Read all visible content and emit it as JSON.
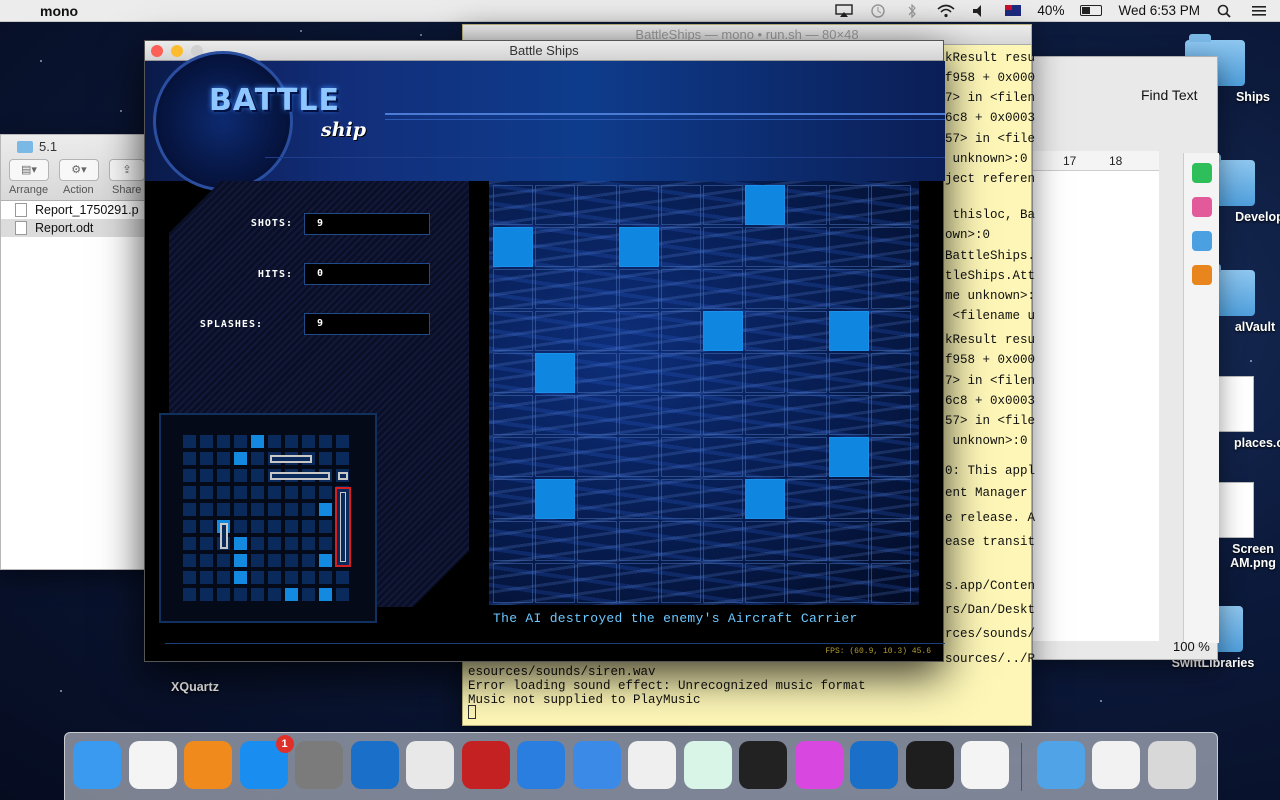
{
  "menubar": {
    "app_name": "mono",
    "battery": "40%",
    "clock": "Wed 6:53 PM"
  },
  "desktop": {
    "icons": [
      {
        "label": "Ships"
      },
      {
        "label": "Developm"
      },
      {
        "label": "alVault"
      },
      {
        "label": "places.o"
      },
      {
        "label": "Screen"
      },
      {
        "label": "AM.png"
      },
      {
        "label": "SwiftLibraries"
      },
      {
        "label": "XQuartz"
      }
    ]
  },
  "finder": {
    "path": "5.1",
    "buttons": {
      "arrange": "Arrange",
      "action": "Action",
      "share": "Share"
    },
    "files": [
      {
        "name": "Report_1750291.p"
      },
      {
        "name": "Report.odt"
      }
    ]
  },
  "docwin": {
    "find_text": "Find Text",
    "ruler": [
      "17",
      "18"
    ],
    "zoom": "100 %"
  },
  "terminal": {
    "title": "BattleShips — mono • run.sh — 80×48",
    "lines": [
      "kResult resu",
      "f958 + 0x000",
      "7> in <filen",
      "6c8 + 0x0003",
      "57> in <file",
      " unknown>:0",
      "ject referen",
      " thisloc, Ba",
      "own>:0",
      "BattleShips.",
      "tleShips.Att",
      "me unknown>:",
      " <filename u",
      "kResult resu",
      "f958 + 0x000",
      "7> in <filen",
      "6c8 + 0x0003",
      "57> in <file",
      " unknown>:0",
      "0: This appl",
      "ent Manager",
      "e release. A",
      "ease transit",
      "s.app/Conten",
      "rs/Dan/Deskt",
      "rces/sounds/",
      "sources/../R",
      "esources/sounds/siren.wav",
      "Error loading sound effect: Unrecognized music format",
      "Music not supplied to PlayMusic"
    ]
  },
  "game": {
    "window_title": "Battle Ships",
    "logo_battle": "BATTLE",
    "logo_ship": "ship",
    "stats": [
      {
        "label": "SHOTS:",
        "value": "9"
      },
      {
        "label": "HITS:",
        "value": "0"
      },
      {
        "label": "SPLASHES:",
        "value": "9"
      }
    ],
    "message": "The AI destroyed the enemy's Aircraft Carrier",
    "fps": "FPS: (60.9, 10.3) 45.6",
    "ocean_grid": {
      "rows": 10,
      "cols": 10,
      "hits": [
        [
          0,
          6
        ],
        [
          1,
          0
        ],
        [
          1,
          3
        ],
        [
          3,
          5
        ],
        [
          3,
          8
        ],
        [
          4,
          1
        ],
        [
          6,
          8
        ],
        [
          7,
          1
        ],
        [
          7,
          6
        ]
      ]
    },
    "mini_grid": {
      "rows": 10,
      "cols": 10,
      "hits": [
        [
          0,
          4
        ],
        [
          1,
          3
        ],
        [
          4,
          8
        ],
        [
          5,
          2
        ],
        [
          6,
          3
        ],
        [
          7,
          3
        ],
        [
          7,
          8
        ],
        [
          8,
          3
        ],
        [
          9,
          6
        ],
        [
          9,
          8
        ]
      ]
    }
  },
  "dock": {
    "apps": [
      {
        "name": "finder-icon",
        "color": "#3a9af0"
      },
      {
        "name": "itunes-icon",
        "color": "#f4f4f4"
      },
      {
        "name": "ibooks-icon",
        "color": "#f08a1c"
      },
      {
        "name": "appstore-icon",
        "color": "#1a8ef0",
        "badge": "1"
      },
      {
        "name": "system-preferences-icon",
        "color": "#7b7b7b"
      },
      {
        "name": "openoffice-icon",
        "color": "#1a6fc8"
      },
      {
        "name": "chrome-icon",
        "color": "#e8e8e8"
      },
      {
        "name": "mono-icon",
        "color": "#c42222"
      },
      {
        "name": "xcode-simulator-icon",
        "color": "#2a7ee0"
      },
      {
        "name": "xcode-icon",
        "color": "#3b8ae8"
      },
      {
        "name": "xamarin-icon",
        "color": "#efefef"
      },
      {
        "name": "atom-icon",
        "color": "#d9f5e8"
      },
      {
        "name": "acrobat-icon",
        "color": "#222222"
      },
      {
        "name": "daisydisk-icon",
        "color": "#d847e0"
      },
      {
        "name": "openoffice-2-icon",
        "color": "#1a6fc8"
      },
      {
        "name": "terminal-icon",
        "color": "#1e1e1e"
      },
      {
        "name": "document-icon",
        "color": "#f4f4f4"
      },
      {
        "name": "downloads-folder-icon",
        "color": "#4fa3e6"
      },
      {
        "name": "screenshot-file-icon",
        "color": "#f2f2f2"
      },
      {
        "name": "trash-icon",
        "color": "#d8d8d8"
      }
    ]
  }
}
